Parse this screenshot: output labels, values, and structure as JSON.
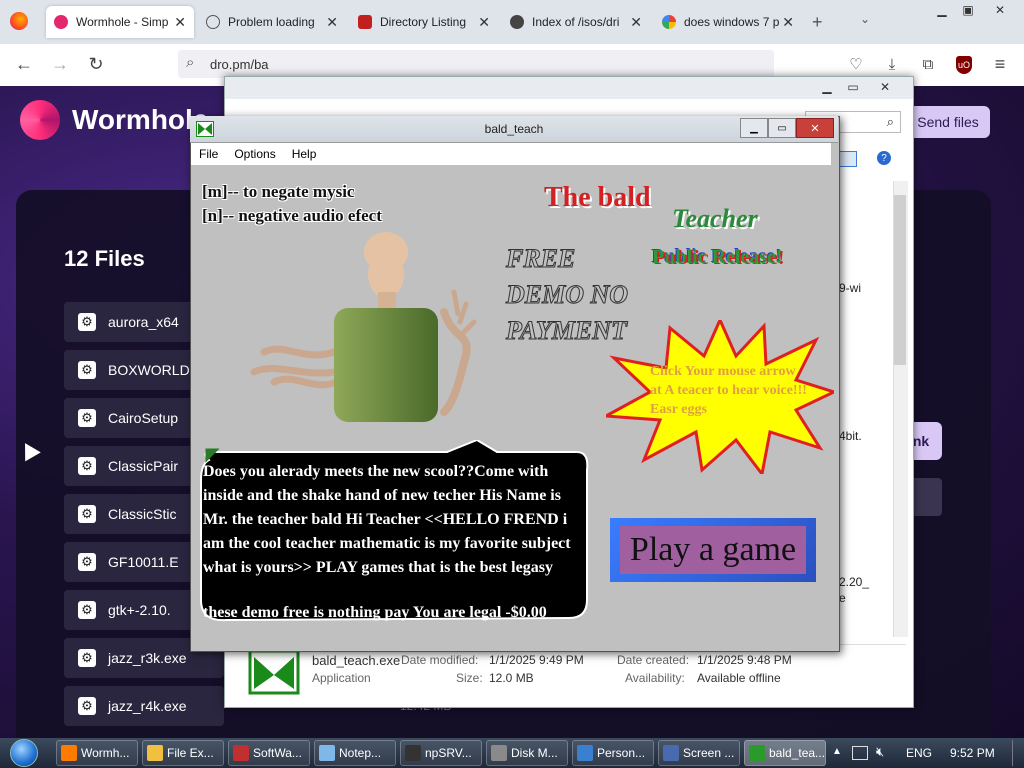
{
  "browser": {
    "tabs": [
      {
        "label": "Wormhole - Simp",
        "icon": "wormhole-icon",
        "color": "#e4286f",
        "active": true
      },
      {
        "label": "Problem loading",
        "icon": "info-icon",
        "color": "#555555"
      },
      {
        "label": "Directory Listing",
        "icon": "red-folder-icon",
        "color": "#c21f1f"
      },
      {
        "label": "Index of /isos/dri",
        "icon": "gear-icon",
        "color": "#444444"
      },
      {
        "label": "does windows 7 p",
        "icon": "google-icon",
        "color": "#4285f4"
      }
    ],
    "url": "dro.pm/ba"
  },
  "page": {
    "logo_text": "Wormhole",
    "send_button": "Send files",
    "file_count": "12 Files",
    "files": [
      "aurora_x64",
      "BOXWORLD",
      "CairoSetup",
      "ClassicPair",
      "ClassicStic",
      "GF10011.E",
      "gtk+-2.10.",
      "jazz_r3k.exe",
      "jazz_r4k.exe"
    ],
    "link_button": "nk",
    "hidden_size": "12.42 MB"
  },
  "explorer": {
    "search_placeholder": "ds",
    "side_texts": [
      "9-wi",
      "4bit.",
      "2.20_",
      "e"
    ],
    "detail": {
      "name": "bald_teach.exe",
      "type": "Application",
      "modified_label": "Date modified:",
      "modified": "1/1/2025 9:49 PM",
      "size_label": "Size:",
      "size": "12.0 MB",
      "created_label": "Date created:",
      "created": "1/1/2025 9:48 PM",
      "availability_label": "Availability:",
      "availability": "Available offline"
    }
  },
  "app": {
    "title": "bald_teach",
    "menu": [
      "File",
      "Options",
      "Help"
    ],
    "controls": [
      "[m]-- to negate mysic",
      "[n]-- negative audio efect"
    ],
    "title_line1": "The bald",
    "title_line2": "Teacher",
    "public_release": "Public Release!",
    "free_lines": [
      "FREE",
      "DEMO NO",
      "PAYMENT"
    ],
    "starburst_text": "Click Your mouse arrow at A teacer to hear voice!!! Easr eggs",
    "speech_text": "Does you alerady meets the new scool??Come with inside and the shake hand of new techer His Name is Mr. the teacher bald Hi Teacher <<HELLO FREND i am the cool teacher mathematic is my favorite subject what is yours>> PLAY games that is the best legasy",
    "speech_footer": "these demo free is nothing pay You are legal -$0.00",
    "play_button": "Play a game",
    "colors": {
      "title_red": "#d42020",
      "teacher_green": "#2a8a3a",
      "starburst": "#ffff00",
      "starburst_border": "#e02020"
    }
  },
  "taskbar": {
    "items": [
      {
        "label": "Wormh...",
        "icon": "firefox-icon",
        "color": "#ff7b00"
      },
      {
        "label": "File Ex...",
        "icon": "folder-icon",
        "color": "#f0c040"
      },
      {
        "label": "SoftWa...",
        "icon": "software-icon",
        "color": "#c03030"
      },
      {
        "label": "Notep...",
        "icon": "notepad-icon",
        "color": "#7fb8e8"
      },
      {
        "label": "npSRV...",
        "icon": "console-icon",
        "color": "#333333"
      },
      {
        "label": "Disk M...",
        "icon": "disk-icon",
        "color": "#8a8a8a"
      },
      {
        "label": "Person...",
        "icon": "personalize-icon",
        "color": "#3a80d0"
      },
      {
        "label": "Screen ...",
        "icon": "screen-icon",
        "color": "#4a6ab0"
      },
      {
        "label": "bald_tea...",
        "icon": "bald-teach-icon",
        "color": "#2a9a2a"
      }
    ],
    "language": "ENG",
    "time": "9:52 PM"
  }
}
